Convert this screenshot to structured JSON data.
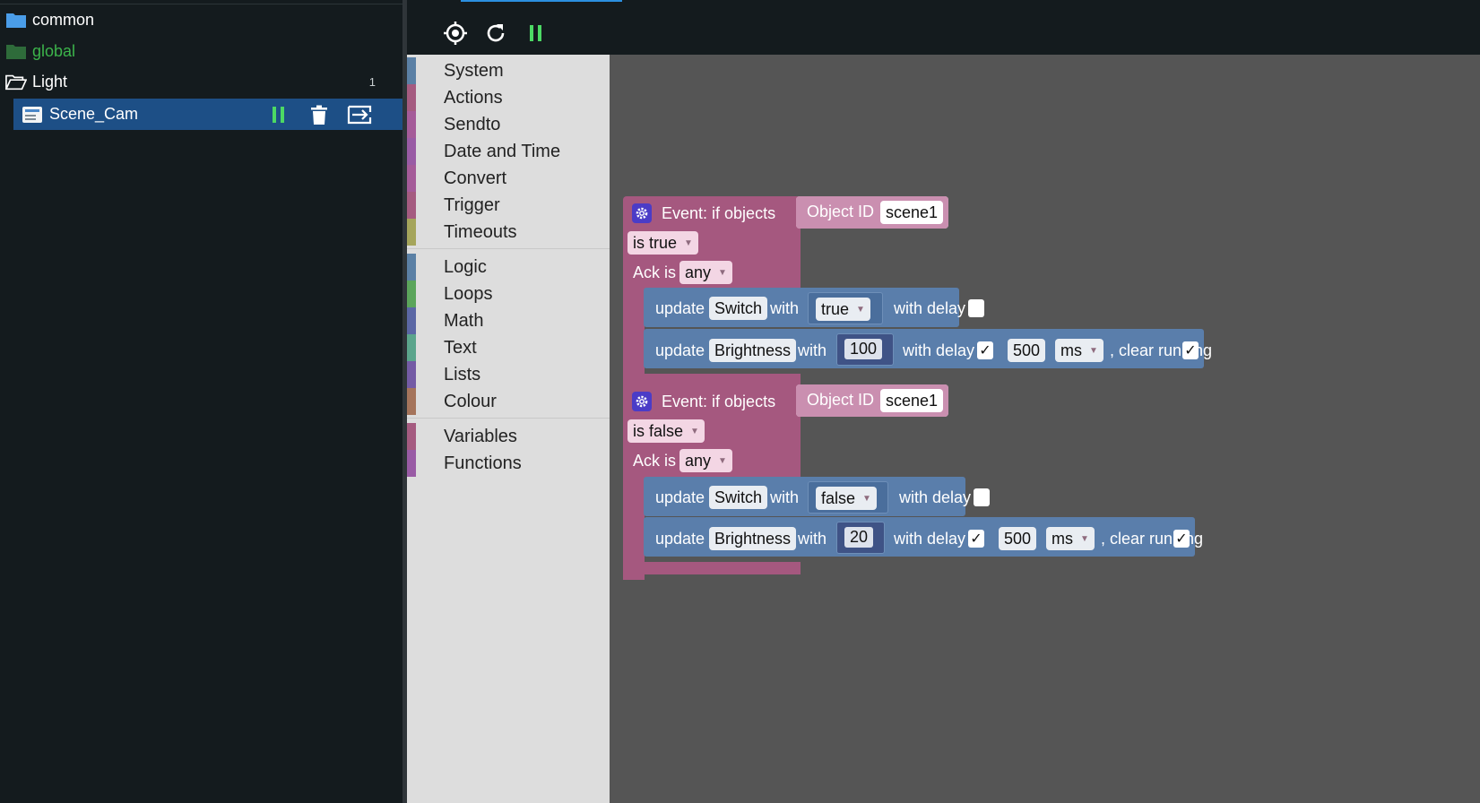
{
  "sidebar": {
    "items": [
      {
        "label": "common",
        "icon": "folder-icon",
        "color": "#4a9de8"
      },
      {
        "label": "global",
        "icon": "folder-icon",
        "color": "#3cb44b"
      },
      {
        "label": "Light",
        "icon": "folder-open-icon",
        "count": "1"
      },
      {
        "label": "Scene_Cam",
        "icon": "script-icon",
        "selected": true
      }
    ]
  },
  "toolbox": {
    "groups": [
      [
        {
          "label": "System",
          "color": "#5b80a5"
        },
        {
          "label": "Actions",
          "color": "#a55b80"
        },
        {
          "label": "Sendto",
          "color": "#a55b99"
        },
        {
          "label": "Date and Time",
          "color": "#995ba5"
        },
        {
          "label": "Convert",
          "color": "#a55b99"
        },
        {
          "label": "Trigger",
          "color": "#a55b80"
        },
        {
          "label": "Timeouts",
          "color": "#a5a55b"
        }
      ],
      [
        {
          "label": "Logic",
          "color": "#5b80a5"
        },
        {
          "label": "Loops",
          "color": "#5ba55b"
        },
        {
          "label": "Math",
          "color": "#5b67a5"
        },
        {
          "label": "Text",
          "color": "#5ba58c"
        },
        {
          "label": "Lists",
          "color": "#745ba5"
        },
        {
          "label": "Colour",
          "color": "#a5745b"
        }
      ],
      [
        {
          "label": "Variables",
          "color": "#a55b80"
        },
        {
          "label": "Functions",
          "color": "#995ba5"
        }
      ]
    ]
  },
  "events": [
    {
      "title": "Event: if objects",
      "object_label": "Object ID",
      "object_value": "scene1",
      "condition": "is true",
      "ack_label": "Ack is",
      "ack_value": "any",
      "switch_row": {
        "update": "update",
        "target": "Switch",
        "with": "with",
        "value": "true",
        "delay_label": "with delay",
        "delay_checked": false
      },
      "brightness_row": {
        "update": "update",
        "target": "Brightness",
        "with": "with",
        "value": "100",
        "delay_label": "with delay",
        "delay_checked": "✓",
        "delay_value": "500",
        "unit": "ms",
        "clear_label": ", clear running",
        "clear_checked": "✓"
      }
    },
    {
      "title": "Event: if objects",
      "object_label": "Object ID",
      "object_value": "scene1",
      "condition": "is false",
      "ack_label": "Ack is",
      "ack_value": "any",
      "switch_row": {
        "update": "update",
        "target": "Switch",
        "with": "with",
        "value": "false",
        "delay_label": "with delay",
        "delay_checked": false
      },
      "brightness_row": {
        "update": "update",
        "target": "Brightness",
        "with": "with",
        "value": "20",
        "delay_label": "with delay",
        "delay_checked": "✓",
        "delay_value": "500",
        "unit": "ms",
        "clear_label": ", clear running",
        "clear_checked": "✓"
      }
    }
  ]
}
